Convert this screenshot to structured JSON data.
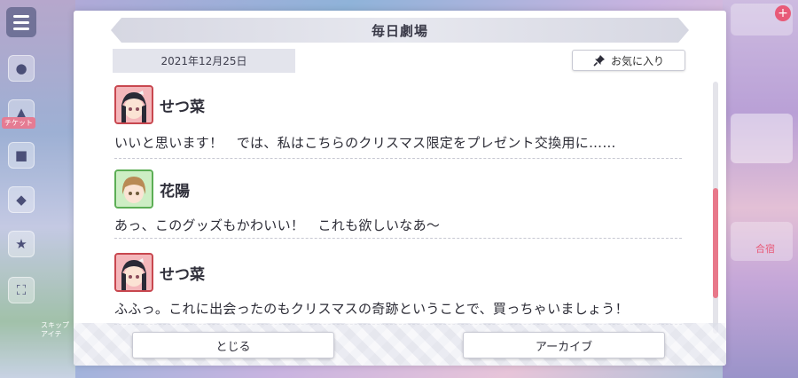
{
  "hud": {
    "left_badge_text": "チケット",
    "bottom_left_text": "スキップ\nアイテ",
    "right_badge_text": "合宿"
  },
  "dialog": {
    "title": "毎日劇場",
    "date": "2021年12月25日",
    "favorite_label": "お気に入り",
    "entries": [
      {
        "speaker": "せつ菜",
        "text": "いいと思います！　では、私はこちらのクリスマス限定をプレゼント交換用に……"
      },
      {
        "speaker": "花陽",
        "text": "あっ、このグッズもかわいい！　これも欲しいなあ〜"
      },
      {
        "speaker": "せつ菜",
        "text": "ふふっ。これに出会ったのもクリスマスの奇跡ということで、買っちゃいましょう！"
      }
    ],
    "close_label": "とじる",
    "archive_label": "アーカイブ"
  },
  "colors": {
    "accent_scroll": "#e8788a",
    "setsuna_frame": "#c8474f",
    "hanayo_frame": "#5cae55"
  },
  "icons": [
    "menu-icon",
    "pin-icon"
  ]
}
